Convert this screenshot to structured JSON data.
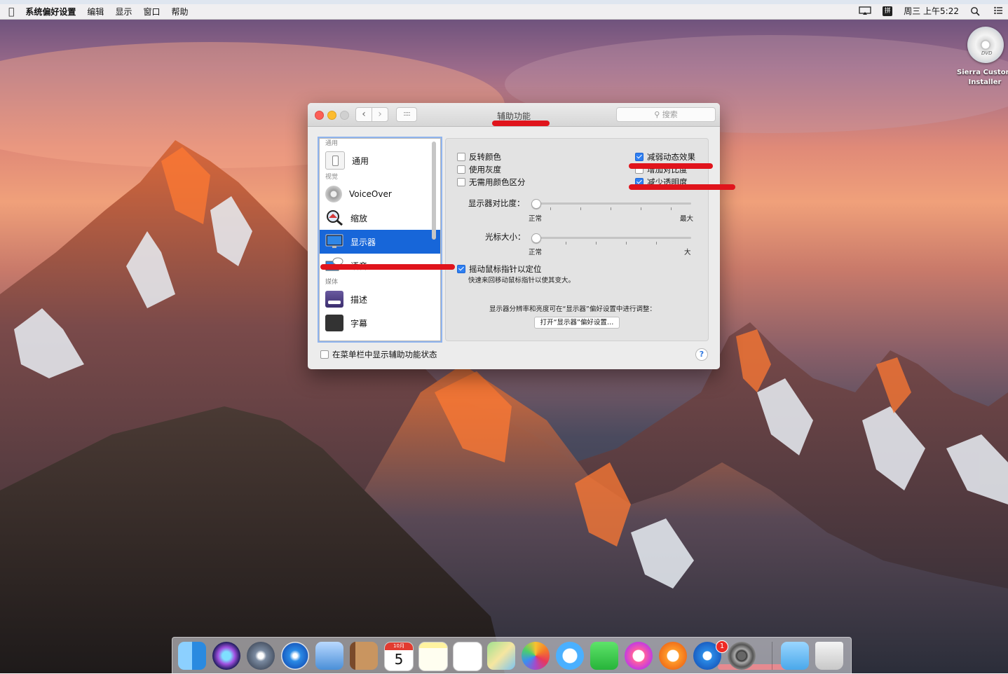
{
  "colors": {
    "accent": "#1766d9",
    "checkbox_on": "#2f7ff1",
    "annotation_red": "#e0141c"
  },
  "menubar": {
    "apple_icon": "apple-icon",
    "app_name": "系统偏好设置",
    "menus": [
      "编辑",
      "显示",
      "窗口",
      "帮助"
    ],
    "status_icons": [
      "airplay-icon",
      "ime-icon",
      "spotlight-icon",
      "notification-center-icon"
    ],
    "ime_label": "拼",
    "clock": "周三 上午5:22"
  },
  "desktop": {
    "dvd_badge": "DVD",
    "dvd_label_line1": "Sierra Custom",
    "dvd_label_line2": "Installer"
  },
  "window": {
    "title": "辅助功能",
    "search_placeholder": "搜索",
    "nav_back": "‹",
    "nav_forward": "›",
    "grid": "::::",
    "sidebar": {
      "sections": {
        "general": "通用",
        "vision": "视觉",
        "media": "媒体"
      },
      "items": {
        "general": "通用",
        "voiceover": "VoiceOver",
        "zoom": "缩放",
        "display": "显示器",
        "speech": "语音",
        "descriptions": "描述",
        "captions": "字幕"
      }
    },
    "options": {
      "invert_colors": {
        "label": "反转颜色",
        "checked": false
      },
      "use_grayscale": {
        "label": "使用灰度",
        "checked": false
      },
      "differentiate_without_color": {
        "label": "无需用颜色区分",
        "checked": false
      },
      "reduce_motion": {
        "label": "减弱动态效果",
        "checked": true
      },
      "increase_contrast": {
        "label": "增加对比度",
        "checked": false
      },
      "reduce_transparency": {
        "label": "减少透明度",
        "checked": true
      }
    },
    "contrast": {
      "label": "显示器对比度：",
      "min_label": "正常",
      "max_label": "最大",
      "value": 0
    },
    "cursor": {
      "label": "光标大小：",
      "min_label": "正常",
      "max_label": "大",
      "value": 0
    },
    "shake": {
      "label": "摇动鼠标指针以定位",
      "checked": true,
      "description": "快速来回移动鼠标指针以使其变大。"
    },
    "display_note": "显示器分辨率和亮度可在“显示器”偏好设置中进行调整：",
    "open_display_button": "打开“显示器”偏好设置…",
    "menubar_status": {
      "label": "在菜单栏中显示辅助功能状态",
      "checked": false
    },
    "help": "?"
  },
  "dock": {
    "apps": [
      "Finder",
      "Siri",
      "Launchpad",
      "Safari",
      "Mail",
      "Contacts",
      "Calendar",
      "Notes",
      "Reminders",
      "Maps",
      "Photos",
      "Messages",
      "FaceTime",
      "iTunes",
      "iBooks",
      "App Store",
      "System Preferences",
      "Downloads",
      "Trash"
    ],
    "calendar_month": "10月",
    "calendar_day": "5",
    "app_store_badge": "1"
  }
}
